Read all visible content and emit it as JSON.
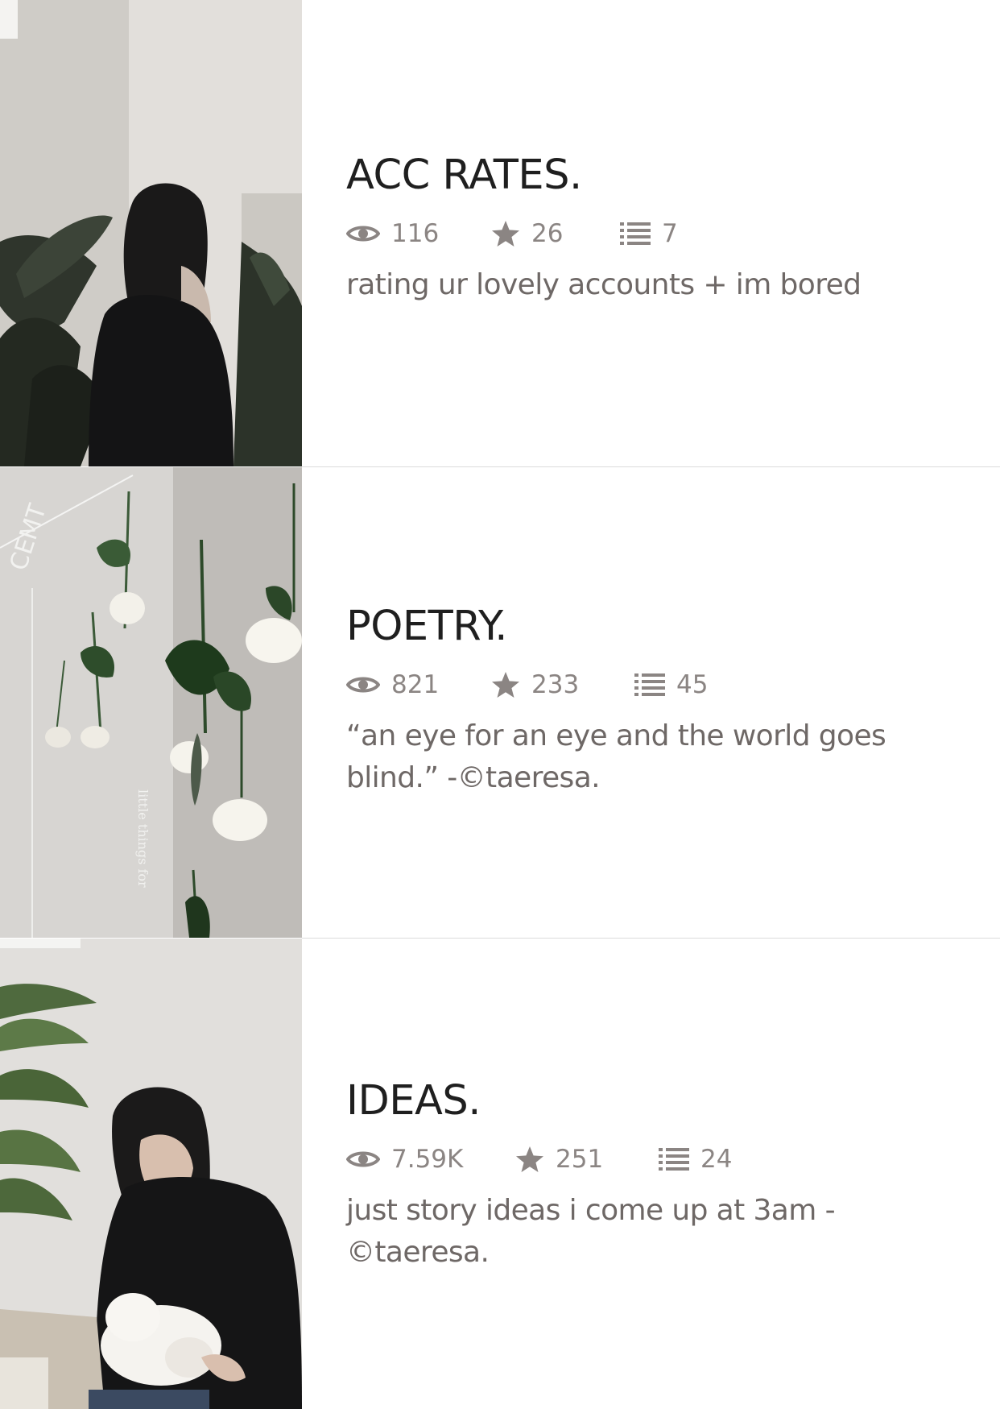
{
  "stories": [
    {
      "title": "ACC RATES.",
      "reads": "116",
      "votes": "26",
      "parts": "7",
      "description": "rating ur lovely accounts + im bored"
    },
    {
      "title": "POETRY.",
      "reads": "821",
      "votes": "233",
      "parts": "45",
      "description": "“an eye for an eye and the world goes blind.”  -©taeresa."
    },
    {
      "title": "IDEAS.",
      "reads": "7.59K",
      "votes": "251",
      "parts": "24",
      "description": "just story ideas i come up at 3am - ©taeresa."
    }
  ],
  "cover_art": {
    "wall_sign": "CEMT",
    "wall_vertical_text": "little things for"
  },
  "icons": {
    "reads": "eye-icon",
    "votes": "star-icon",
    "parts": "list-icon"
  },
  "colors": {
    "title": "#1f1f1f",
    "meta": "#8b8583",
    "description": "#6e6866",
    "divider": "#dcdcdc"
  }
}
